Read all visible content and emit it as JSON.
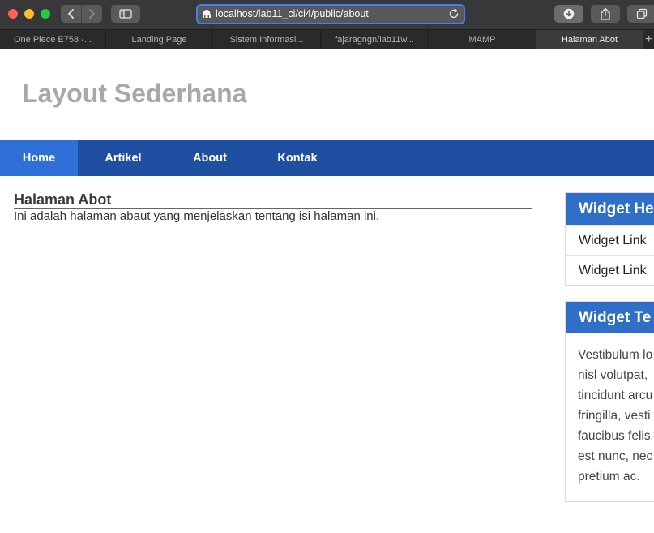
{
  "browser": {
    "url": "localhost/lab11_ci/ci4/public/about",
    "tabs": [
      {
        "label": "One Piece E758 -..."
      },
      {
        "label": "Landing Page"
      },
      {
        "label": "Sistem Informasi..."
      },
      {
        "label": "fajaragngn/lab11w..."
      },
      {
        "label": "MAMP"
      },
      {
        "label": "Halaman Abot"
      }
    ],
    "active_tab_index": 5,
    "new_tab_glyph": "+",
    "icons": {
      "back": "chevron-left-icon",
      "forward": "chevron-right-icon",
      "sidebar": "sidebar-icon",
      "site": "site-icon",
      "reload": "reload-icon",
      "download": "download-icon",
      "share": "share-icon",
      "tabs_overview": "tabs-overview-icon"
    },
    "colors": {
      "url_focus_ring": "#3a82f7",
      "close": "#fe5f57",
      "minimize": "#febc2e",
      "zoom": "#28c840"
    }
  },
  "site": {
    "title": "Layout Sederhana",
    "nav": [
      {
        "label": "Home"
      },
      {
        "label": "Artikel"
      },
      {
        "label": "About"
      },
      {
        "label": "Kontak"
      }
    ],
    "active_nav_index": 0,
    "colors": {
      "nav_bg": "#1f4fa0",
      "nav_active": "#2e6fd8",
      "widget_header": "#2f6fc8",
      "title": "#a8a8a8"
    }
  },
  "main": {
    "heading": "Halaman Abot",
    "body": "Ini adalah halaman abaut yang menjelaskan tentang isi halaman ini."
  },
  "sidebar": {
    "widget1": {
      "title": "Widget He",
      "links": [
        {
          "label": "Widget Link"
        },
        {
          "label": "Widget Link"
        }
      ]
    },
    "widget2": {
      "title": "Widget Te",
      "lines": [
        "Vestibulum lo",
        "nisl volutpat,",
        "tincidunt arcu",
        "fringilla, vesti",
        "faucibus felis",
        "est nunc, nec",
        "pretium ac."
      ]
    }
  }
}
